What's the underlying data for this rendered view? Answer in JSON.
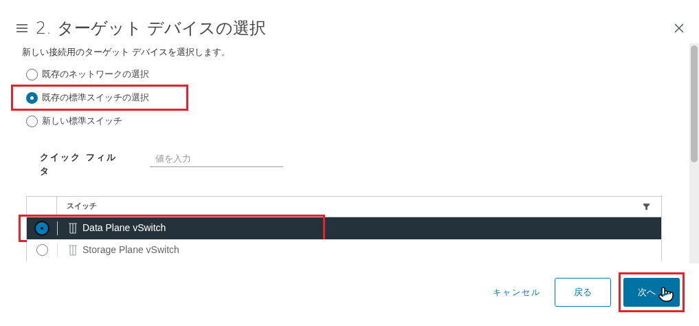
{
  "dialog": {
    "title": "2. ターゲット デバイスの選択",
    "description": "新しい接続用のターゲット デバイスを選択します。"
  },
  "options": [
    {
      "label": "既存のネットワークの選択",
      "selected": false,
      "highlighted": false
    },
    {
      "label": "既存の標準スイッチの選択",
      "selected": true,
      "highlighted": true
    },
    {
      "label": "新しい標準スイッチ",
      "selected": false,
      "highlighted": false
    }
  ],
  "quick_filter": {
    "label": "クイック フィルタ",
    "placeholder": "値を入力"
  },
  "table": {
    "columns": [
      "スイッチ"
    ],
    "rows": [
      {
        "name": "Data Plane vSwitch",
        "selected": true,
        "highlighted": true
      },
      {
        "name": "Storage Plane vSwitch",
        "selected": false,
        "highlighted": false
      }
    ]
  },
  "buttons": [
    {
      "kind": "link",
      "label": "キャンセル",
      "highlighted": false
    },
    {
      "kind": "outline",
      "label": "戻る",
      "highlighted": false
    },
    {
      "kind": "primary",
      "label": "次へ",
      "highlighted": true
    }
  ]
}
